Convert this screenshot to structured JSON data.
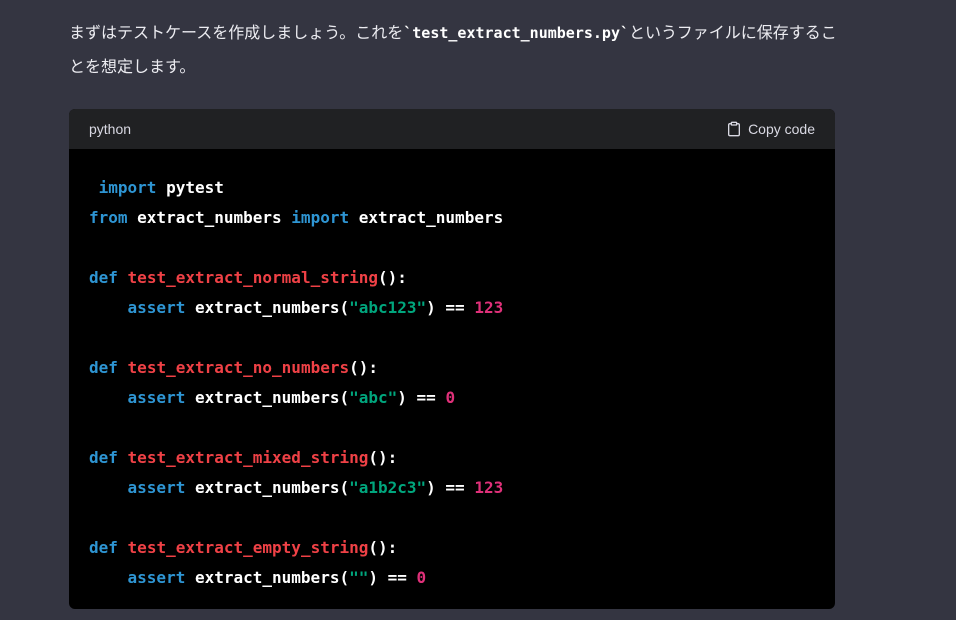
{
  "intro": {
    "text_before": "まずはテストケースを作成しましょう。これを",
    "inline_code": "`test_extract_numbers.py`",
    "text_after": "というファイルに保存することを想定します。"
  },
  "code_block": {
    "language": "python",
    "copy_label": "Copy code",
    "lines": {
      "l1": {
        "kw": "import",
        "rest": " pytest"
      },
      "l2": {
        "kw1": "from",
        "mid": " extract_numbers ",
        "kw2": "import",
        "rest": " extract_numbers"
      },
      "l4": {
        "kw": "def",
        "fn": "test_extract_normal_string",
        "end": "():"
      },
      "l5": {
        "kw": "assert",
        "call": " extract_numbers(",
        "str": "\"abc123\"",
        "op": ") == ",
        "num": "123"
      },
      "l7": {
        "kw": "def",
        "fn": "test_extract_no_numbers",
        "end": "():"
      },
      "l8": {
        "kw": "assert",
        "call": " extract_numbers(",
        "str": "\"abc\"",
        "op": ") == ",
        "num": "0"
      },
      "l10": {
        "kw": "def",
        "fn": "test_extract_mixed_string",
        "end": "():"
      },
      "l11": {
        "kw": "assert",
        "call": " extract_numbers(",
        "str": "\"a1b2c3\"",
        "op": ") == ",
        "num": "123"
      },
      "l13": {
        "kw": "def",
        "fn": "test_extract_empty_string",
        "end": "():"
      },
      "l14": {
        "kw": "assert",
        "call": " extract_numbers(",
        "str": "\"\"",
        "op": ") == ",
        "num": "0"
      }
    }
  },
  "colors": {
    "background": "#343541",
    "code_background": "#000000",
    "header_background": "#202123",
    "keyword": "#2e95d3",
    "function_name": "#ef4146",
    "string": "#00a67d",
    "number": "#df3079"
  },
  "icons": {
    "copy": "clipboard-icon"
  }
}
